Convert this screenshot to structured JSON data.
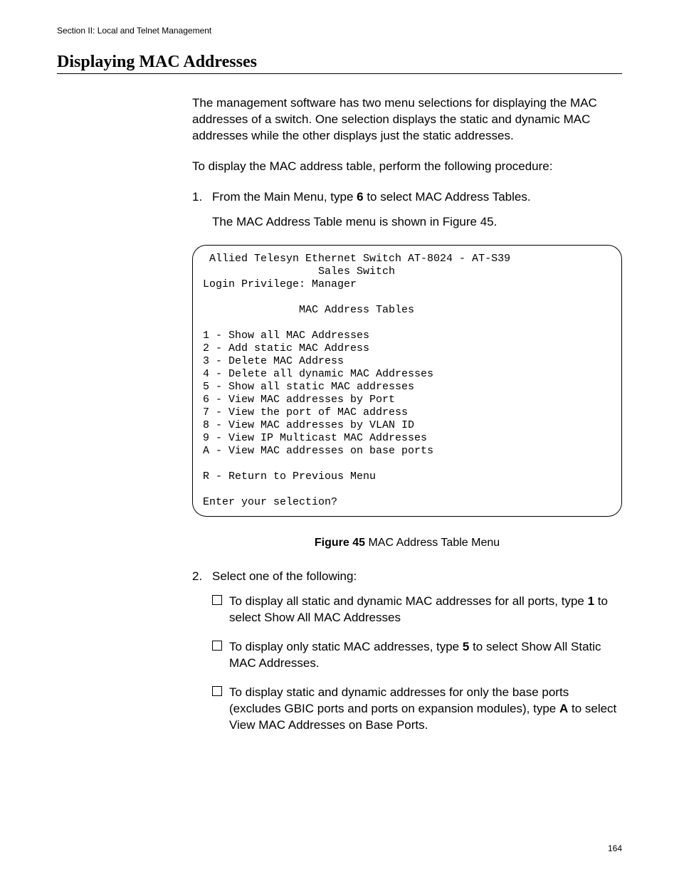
{
  "header": {
    "running": "Section II: Local and Telnet Management"
  },
  "title": "Displaying MAC Addresses",
  "intro": {
    "p1": "The management software has two menu selections for displaying the MAC addresses of a switch. One selection displays the static and dynamic MAC addresses while the other displays just the static addresses.",
    "p2": "To display the MAC address table, perform the following procedure:"
  },
  "step1": {
    "num": "1.",
    "line_a": "From the Main Menu, type ",
    "bold_a": "6",
    "line_b": " to select MAC Address Tables.",
    "sub": "The MAC Address Table menu is shown in Figure 45."
  },
  "terminal": {
    "l1": " Allied Telesyn Ethernet Switch AT-8024 - AT-S39",
    "l2": "                  Sales Switch",
    "l3": "Login Privilege: Manager",
    "l4": "               MAC Address Tables",
    "m1": "1 - Show all MAC Addresses",
    "m2": "2 - Add static MAC Address",
    "m3": "3 - Delete MAC Address",
    "m4": "4 - Delete all dynamic MAC Addresses",
    "m5": "5 - Show all static MAC addresses",
    "m6": "6 - View MAC addresses by Port",
    "m7": "7 - View the port of MAC address",
    "m8": "8 - View MAC addresses by VLAN ID",
    "m9": "9 - View IP Multicast MAC Addresses",
    "m10": "A - View MAC addresses on base ports",
    "r": "R - Return to Previous Menu",
    "prompt": "Enter your selection?"
  },
  "figure": {
    "label": "Figure 45",
    "caption": "  MAC Address Table Menu"
  },
  "step2": {
    "num": "2.",
    "line": "Select one of the following:",
    "b1a": "To display all static and dynamic MAC addresses for all ports, type ",
    "b1bold": "1",
    "b1b": " to select Show All MAC Addresses",
    "b2a": "To display only static MAC addresses, type ",
    "b2bold": "5",
    "b2b": " to select Show All Static MAC Addresses.",
    "b3a": "To display static and dynamic addresses for only the base ports (excludes GBIC ports and ports on expansion modules), type ",
    "b3bold": "A",
    "b3b": " to select View MAC Addresses on Base Ports."
  },
  "pagenum": "164"
}
